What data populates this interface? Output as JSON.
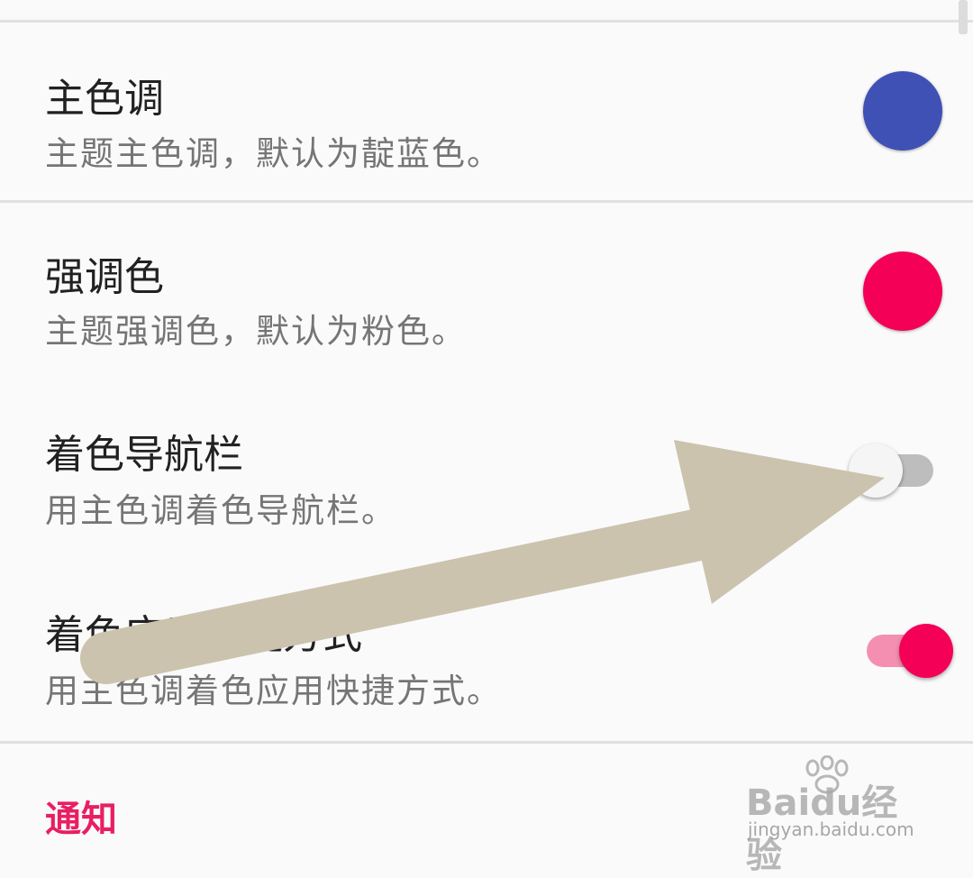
{
  "settings": {
    "items": [
      {
        "title": "主色调",
        "summary": "主题主色调，默认为靛蓝色。",
        "control": "color-swatch",
        "color": "#3f51b5"
      },
      {
        "title": "强调色",
        "summary": "主题强调色，默认为粉色。",
        "control": "color-swatch",
        "color": "#f50057"
      },
      {
        "title": "着色导航栏",
        "summary": "用主色调着色导航栏。",
        "control": "switch",
        "checked": false
      },
      {
        "title": "着色应用快捷方式",
        "summary": "用主色调着色应用快捷方式。",
        "control": "switch",
        "checked": true
      }
    ],
    "category": "通知"
  },
  "colors": {
    "accent": "#e91e63",
    "switch_on_thumb": "#f50057",
    "switch_on_track": "#f48fb1",
    "switch_off_thumb": "#f5f5f5",
    "switch_off_track": "#bdbdbd",
    "annotation_arrow": "#cbc3ae"
  },
  "watermark": {
    "logo": "Baidu经验",
    "url": "jingyan.baidu.com"
  }
}
